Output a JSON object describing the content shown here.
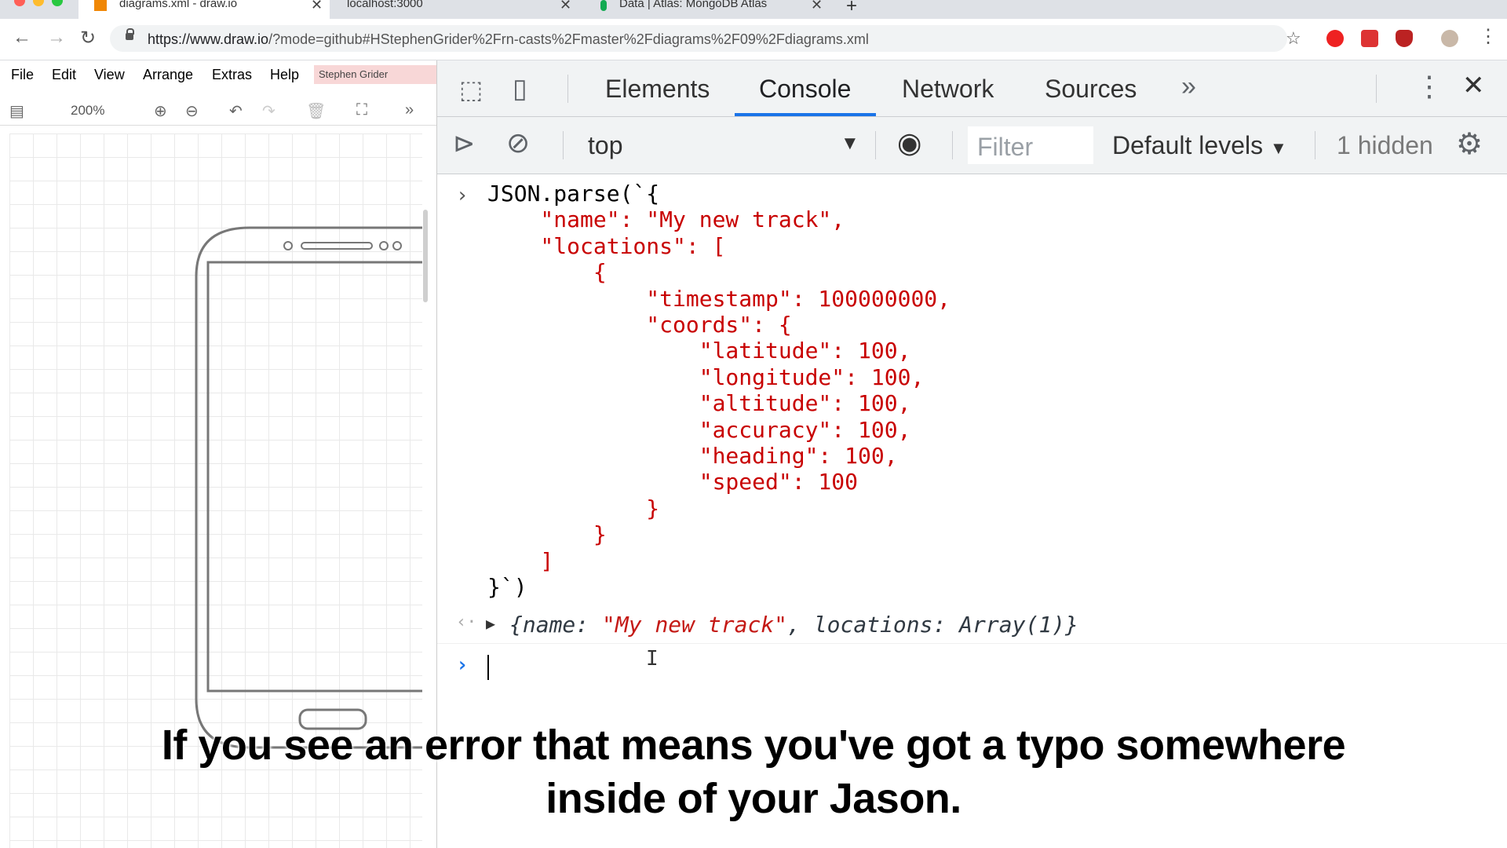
{
  "browser": {
    "tabs": [
      {
        "title": "diagrams.xml - draw.io",
        "active": true
      },
      {
        "title": "localhost:3000",
        "active": false
      },
      {
        "title": "Data | Atlas: MongoDB Atlas",
        "active": false
      }
    ],
    "url_host": "https://www.draw.io",
    "url_rest": "/?mode=github#HStephenGrider%2Frn-casts%2Fmaster%2Fdiagrams%2F09%2Fdiagrams.xml",
    "colors": {
      "accent": "#1a73e8"
    }
  },
  "drawio": {
    "menu": [
      "File",
      "Edit",
      "View",
      "Arrange",
      "Extras",
      "Help"
    ],
    "user": "Stephen Grider",
    "zoom": "200%"
  },
  "devtools": {
    "tabs": [
      "Elements",
      "Console",
      "Network",
      "Sources"
    ],
    "selected_tab": "Console",
    "context": "top",
    "filter_placeholder": "Filter",
    "levels": "Default levels",
    "hidden": "1 hidden"
  },
  "console": {
    "input_lines": [
      "JSON.parse(`{",
      "    \"name\": \"My new track\",",
      "    \"locations\": [",
      "        {",
      "            \"timestamp\": 100000000,",
      "            \"coords\": {",
      "                \"latitude\": 100,",
      "                \"longitude\": 100,",
      "                \"altitude\": 100,",
      "                \"accuracy\": 100,",
      "                \"heading\": 100,",
      "                \"speed\": 100",
      "            }",
      "        }",
      "    ]",
      "}`)"
    ],
    "result_prefix": "{name: ",
    "result_name": "\"My new track\"",
    "result_suffix": ", locations: Array(1)}"
  },
  "subtitle": {
    "line1": "If you see an error that means you've got a typo somewhere",
    "line2": "inside of your Jason."
  }
}
